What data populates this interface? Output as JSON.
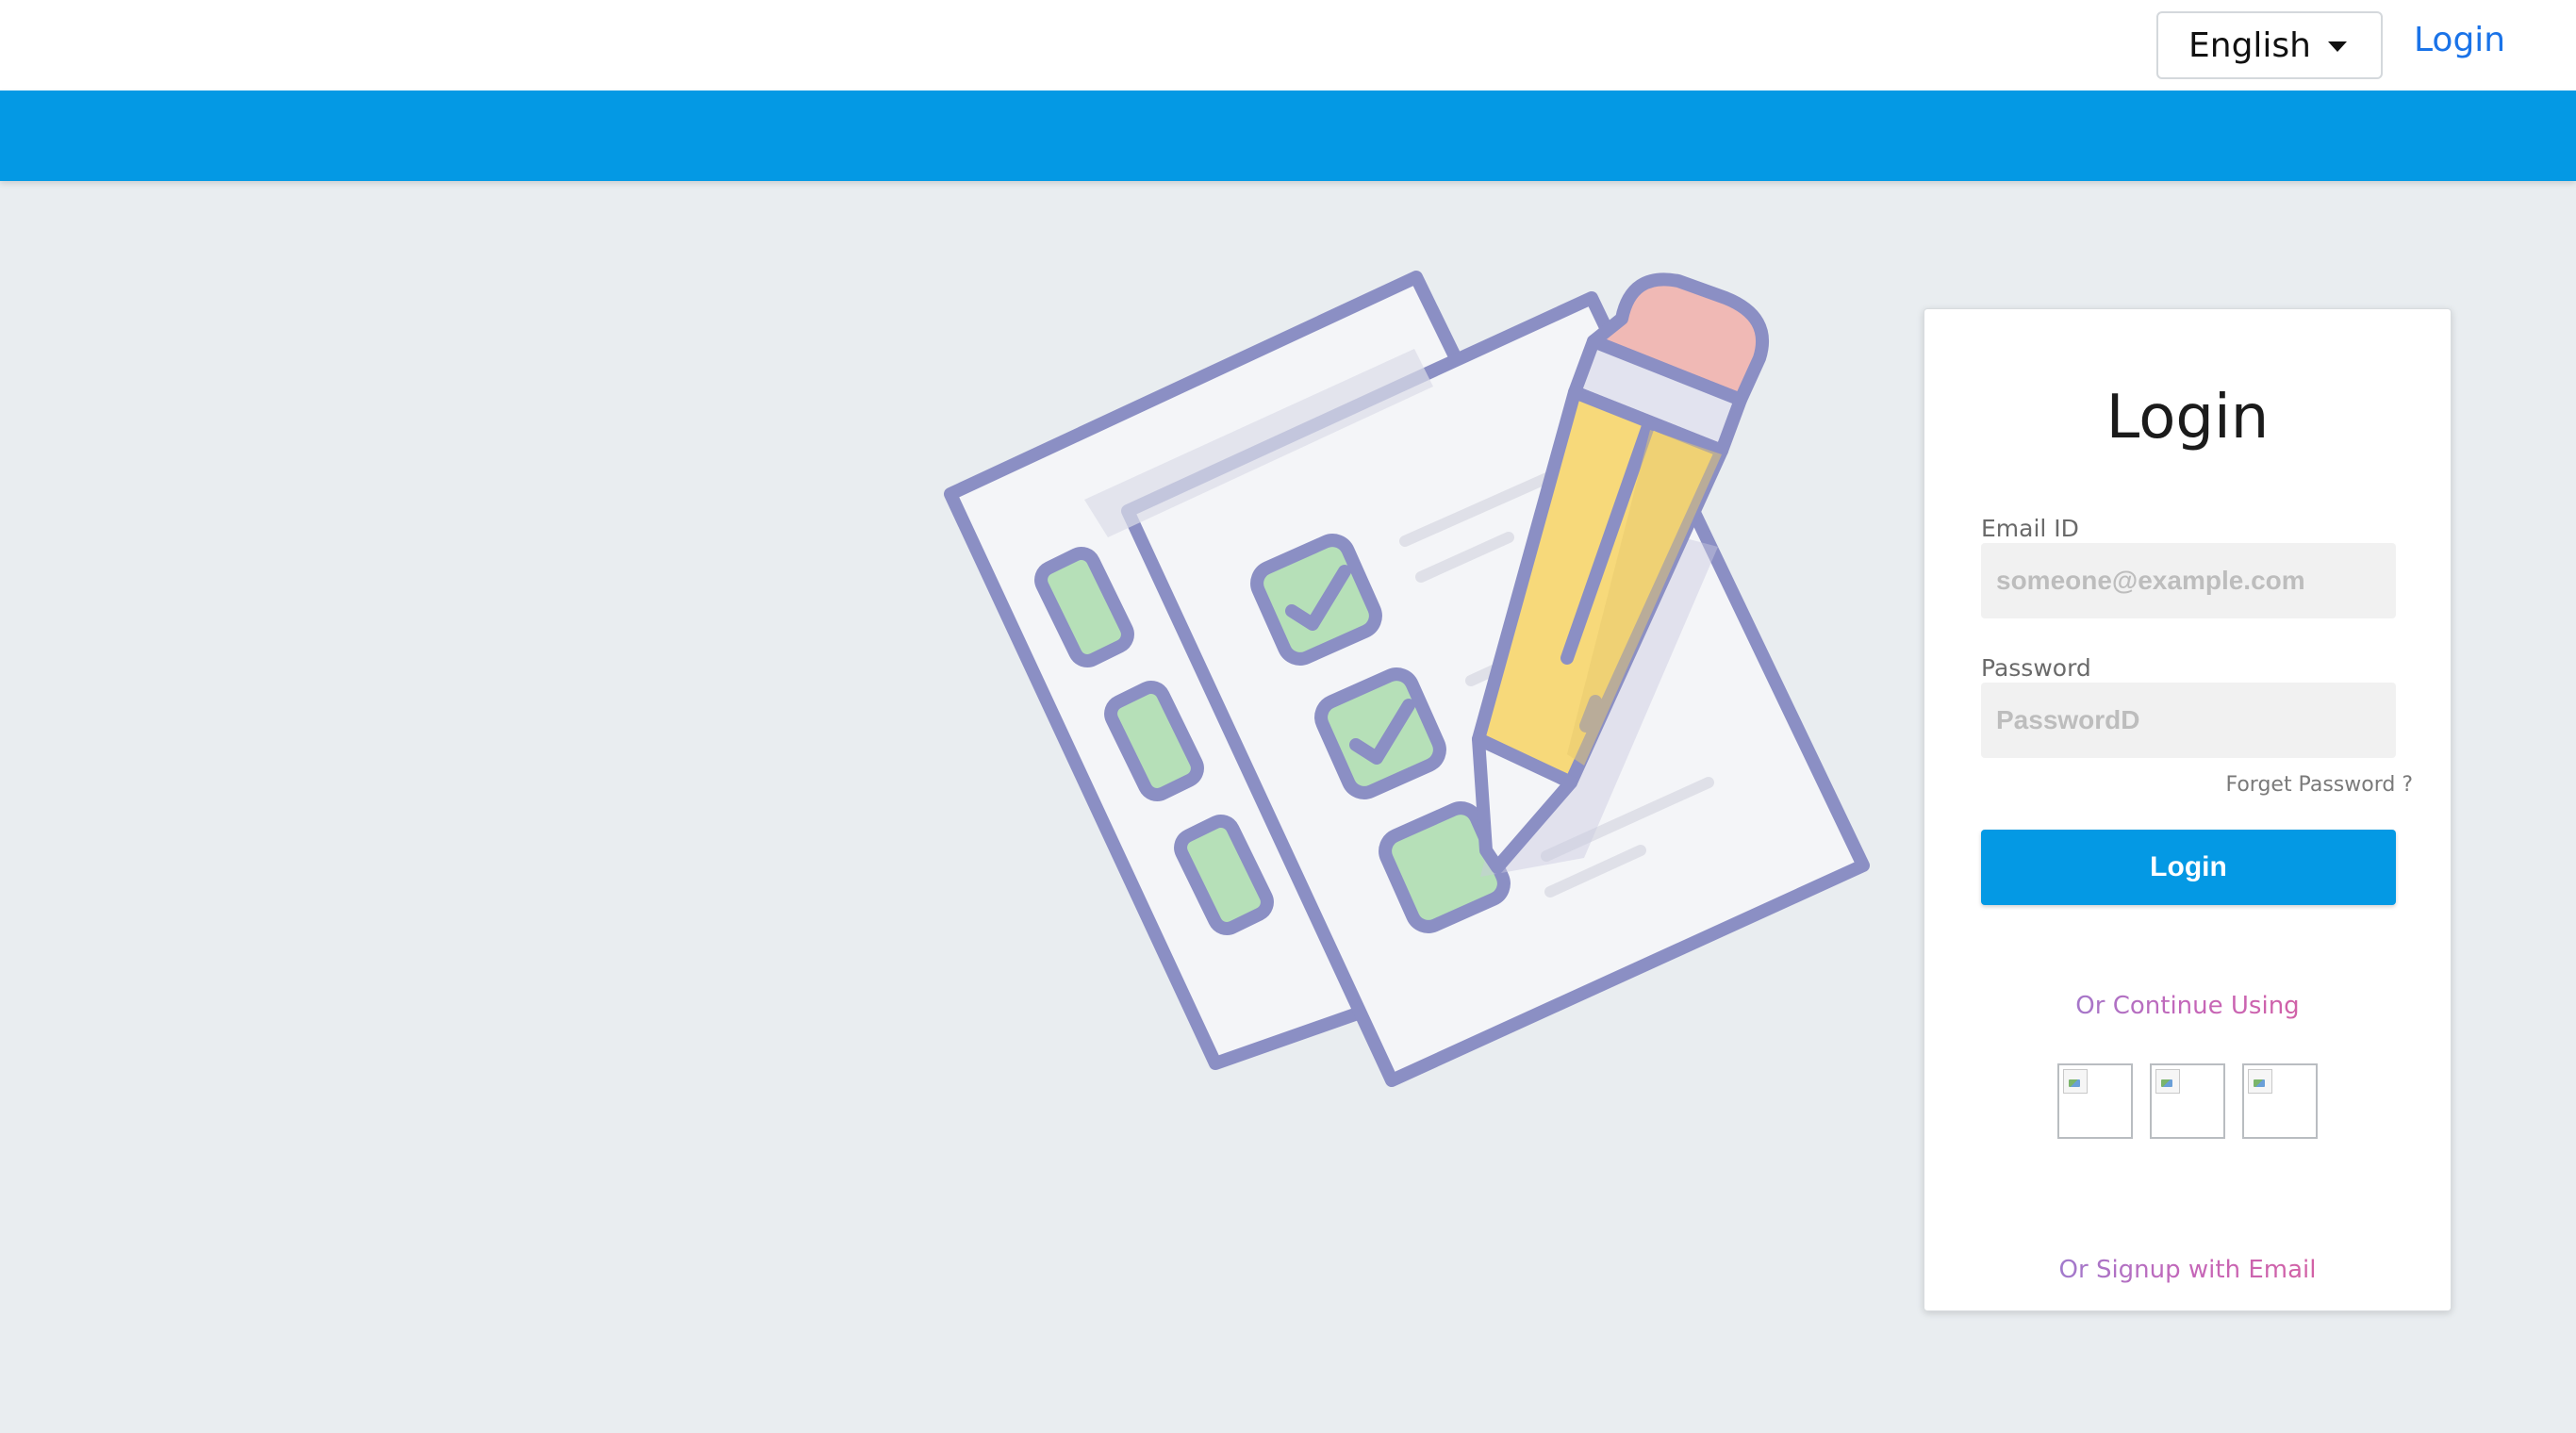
{
  "header": {
    "language": "English",
    "login_link": "Login"
  },
  "login_card": {
    "title": "Login",
    "email": {
      "label": "Email ID",
      "placeholder": "someone@example.com",
      "value": ""
    },
    "password": {
      "label": "Password",
      "placeholder": "PasswordD",
      "value": ""
    },
    "forget_password": "Forget Password ?",
    "login_button": "Login",
    "continue_text": "Or Continue Using",
    "social_buttons": [
      "social-login-1",
      "social-login-2",
      "social-login-3"
    ],
    "signup_text": "Or Signup with Email"
  },
  "colors": {
    "accent": "#0499e4",
    "link": "#1a73e8",
    "illustration_outline": "#8b8fc4",
    "check_fill": "#b6e0b8",
    "pencil": "#f7d97a",
    "eraser": "#f0b9b5"
  },
  "illustration": {
    "name": "checklist-with-pencil"
  }
}
